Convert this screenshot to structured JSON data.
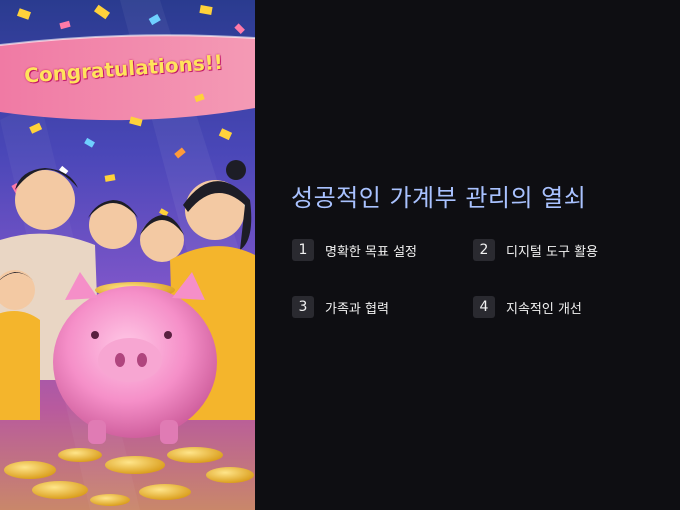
{
  "banner": {
    "text": "Congratulations!!"
  },
  "illustration": {
    "subject": "family-celebrating-with-piggy-bank"
  },
  "slide": {
    "title": "성공적인 가계부 관리의 열쇠",
    "items": [
      {
        "number": "1",
        "label": "명확한 목표 설정"
      },
      {
        "number": "2",
        "label": "디지털 도구 활용"
      },
      {
        "number": "3",
        "label": "가족과 협력"
      },
      {
        "number": "4",
        "label": "지속적인 개선"
      }
    ]
  },
  "colors": {
    "title": "#a9c2ff",
    "background": "#0e0e12",
    "badge": "#2a2a30",
    "text": "#f2f2f2"
  }
}
